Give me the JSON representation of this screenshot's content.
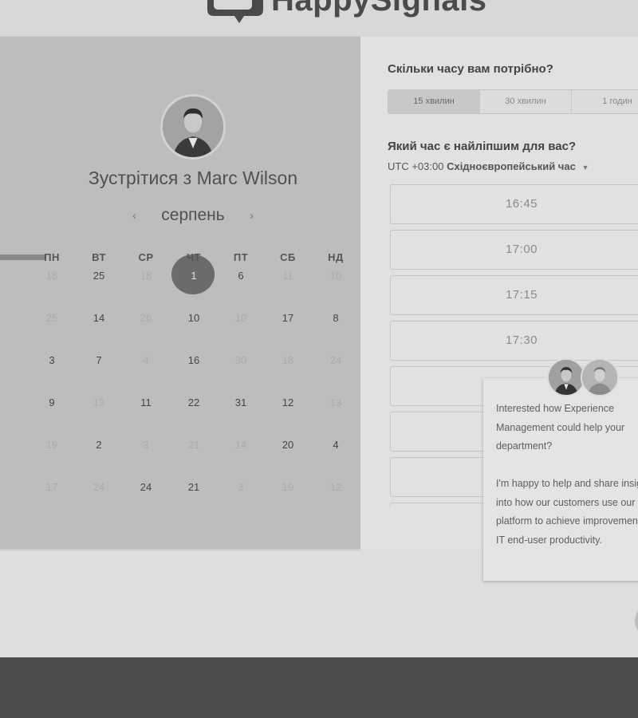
{
  "brand": {
    "name": "HappySignals"
  },
  "host": {
    "title": "Зустрітися з Marc Wilson"
  },
  "calendar": {
    "month": "серпень",
    "prev_arrow": "‹",
    "next_arrow": "›",
    "weekdays": [
      "ПН",
      "ВТ",
      "СР",
      "ЧТ",
      "ПТ",
      "СБ",
      "НД"
    ],
    "weeks": [
      [
        {
          "t": "18",
          "f": true
        },
        {
          "t": "25",
          "f": false
        },
        {
          "t": "18",
          "f": true
        },
        {
          "t": "1",
          "f": false,
          "s": true
        },
        {
          "t": "6",
          "f": false
        },
        {
          "t": "11",
          "f": true
        },
        {
          "t": "10",
          "f": true
        }
      ],
      [
        {
          "t": "25",
          "f": true
        },
        {
          "t": "14",
          "f": false
        },
        {
          "t": "26",
          "f": true
        },
        {
          "t": "10",
          "f": false
        },
        {
          "t": "10",
          "f": true
        },
        {
          "t": "17",
          "f": false
        },
        {
          "t": "8",
          "f": false
        }
      ],
      [
        {
          "t": "3",
          "f": false
        },
        {
          "t": "7",
          "f": false
        },
        {
          "t": "4",
          "f": true
        },
        {
          "t": "16",
          "f": false
        },
        {
          "t": "30",
          "f": true
        },
        {
          "t": "18",
          "f": true
        },
        {
          "t": "24",
          "f": true
        }
      ],
      [
        {
          "t": "9",
          "f": false
        },
        {
          "t": "13",
          "f": true
        },
        {
          "t": "11",
          "f": false
        },
        {
          "t": "22",
          "f": false
        },
        {
          "t": "31",
          "f": false
        },
        {
          "t": "12",
          "f": false
        },
        {
          "t": "13",
          "f": true
        }
      ],
      [
        {
          "t": "19",
          "f": true
        },
        {
          "t": "2",
          "f": false
        },
        {
          "t": "3",
          "f": true
        },
        {
          "t": "21",
          "f": true
        },
        {
          "t": "14",
          "f": true
        },
        {
          "t": "20",
          "f": false
        },
        {
          "t": "4",
          "f": false
        }
      ],
      [
        {
          "t": "17",
          "f": true
        },
        {
          "t": "24",
          "f": true
        },
        {
          "t": "24",
          "f": false
        },
        {
          "t": "21",
          "f": false
        },
        {
          "t": "3",
          "f": true
        },
        {
          "t": "19",
          "f": true
        },
        {
          "t": "12",
          "f": true
        }
      ]
    ]
  },
  "duration": {
    "heading": "Скільки часу вам потрібно?",
    "options": [
      "15 хвилин",
      "30 хвилин",
      "1 годин"
    ],
    "selected": "15 хвилин"
  },
  "time": {
    "heading": "Який час є найліпшим для вас?",
    "tz_offset": "UTC +03:00",
    "tz_name": "Східноєвропейський час",
    "slots": [
      "16:45",
      "17:00",
      "17:15",
      "17:30",
      "",
      "",
      "",
      ""
    ]
  },
  "chat": {
    "paragraph1": "Interested how Experience Management could help your department?",
    "paragraph2": "I'm happy to help and share insight into how our customers use our platform to achieve improvement in IT end-user productivity."
  }
}
